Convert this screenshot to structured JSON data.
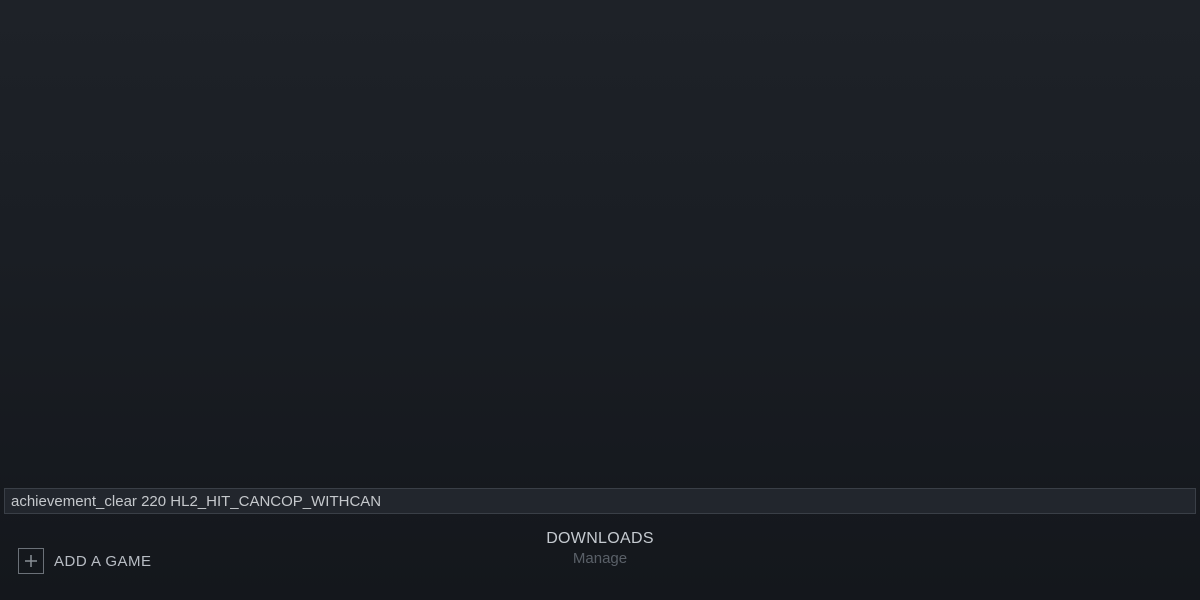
{
  "console": {
    "input_value": "achievement_clear 220 HL2_HIT_CANCOP_WITHCAN"
  },
  "bottom_bar": {
    "add_game_label": "ADD A GAME",
    "downloads": {
      "title": "DOWNLOADS",
      "subtitle": "Manage"
    }
  }
}
